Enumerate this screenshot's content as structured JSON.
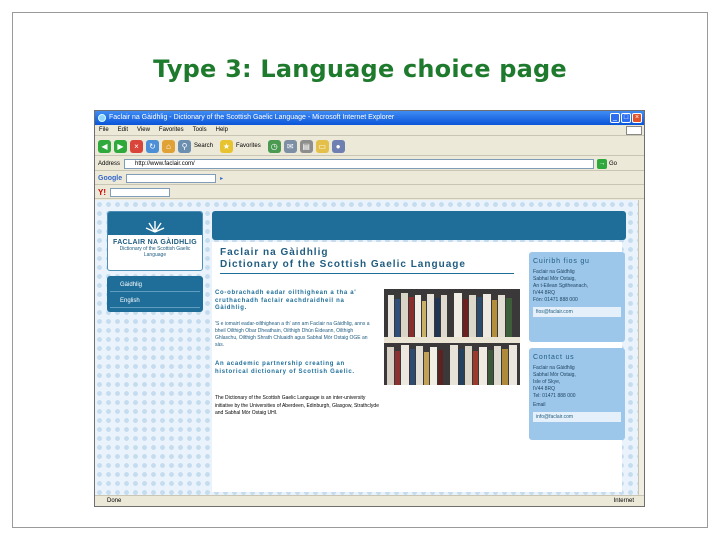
{
  "slide": {
    "title": "Type 3: Language choice page"
  },
  "window": {
    "title": "Faclair na Gàidhlig - Dictionary of the Scottish Gaelic Language - Microsoft Internet Explorer"
  },
  "menu": [
    "File",
    "Edit",
    "View",
    "Favorites",
    "Tools",
    "Help"
  ],
  "toolbar": {
    "search_label": "Search",
    "favorites_label": "Favorites"
  },
  "address": {
    "label": "Address",
    "url": "http://www.faclair.com/",
    "go_label": "Go"
  },
  "google_bar": {
    "brand": "Google"
  },
  "yahoo_bar": {
    "brand": "Y!"
  },
  "site": {
    "name": "FACLAIR NA GÀIDHLIG",
    "subtitle": "Dictionary of the Scottish Gaelic Language",
    "nav": [
      "Gàidhlig",
      "English"
    ],
    "heading_gd": "Faclair na Gàidhlig",
    "heading_en": "Dictionary of the Scottish Gaelic Language",
    "gaelic_intro": "Co-obrachadh eadar oilthighean a tha a' cruthachadh faclair eachdraidheil na Gàidhlig.",
    "gaelic_body": "'S e iomairt eadar-oilthighean a th' ann am Faclair na Gàidhlig, anns a bheil Oilthigh Obar Dheathain, Oilthigh Dhùn Èideann, Oilthigh Ghlaschu, Oilthigh Shrath Chluaidh agus Sabhal Mòr Ostaig OGE an sàs.",
    "english_intro": "An academic partnership creating an historical dictionary of Scottish Gaelic.",
    "english_body": "The Dictionary of the Scottish Gaelic Language is an inter-university initiative by the Universities of Aberdeen, Edinburgh, Glasgow, Strathclyde and Sabhal Mòr Ostaig UHI.",
    "contact_gd": {
      "title": "Cuiribh fios gu",
      "lines": [
        "Faclair na Gàidhlig",
        "Sabhal Mòr Ostaig,",
        "An t-Eilean Sgitheanach,",
        "IV44 8RQ",
        "Fòn: 01471 888 000"
      ],
      "link": "fios@faclair.com"
    },
    "contact_en": {
      "title": "Contact us",
      "lines": [
        "Faclair na Gàidhlig",
        "Sabhal Mòr Ostaig,",
        "Isle of Skye,",
        "IV44 8RQ",
        "Tel: 01471 888 000"
      ],
      "email_label": "Email",
      "link": "info@faclair.com"
    }
  },
  "status": {
    "left": "Done",
    "right": "Internet"
  }
}
